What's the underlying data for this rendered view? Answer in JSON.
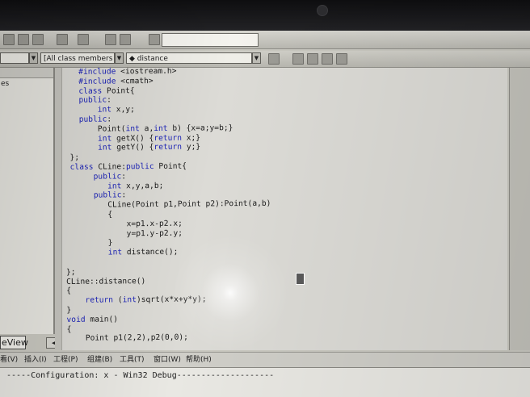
{
  "toolbar": {
    "icons": [
      "cut-icon",
      "copy-icon",
      "paste-icon",
      "undo-icon",
      "redo-icon",
      "window-icon",
      "find-icon",
      "binoculars-icon"
    ],
    "find_value": ""
  },
  "wizard_bar": {
    "scope_value": "",
    "class_value": "[All class members",
    "member_value": "◆ distance"
  },
  "workspace": {
    "pane_label": "es",
    "tab_label": "eView"
  },
  "editor": {
    "lines": [
      "    #include <iostream.h>",
      "    #include <cmath>",
      "    class Point{",
      "    public:",
      "        int x,y;",
      "    public:",
      "        Point(int a,int b) {x=a;y=b;}",
      "        int getX() {return x;}",
      "        int getY() {return y;}",
      "  };",
      "  class CLine:public Point{",
      "       public:",
      "          int x,y,a,b;",
      "       public:",
      "          CLine(Point p1,Point p2):Point(a,b)",
      "          {",
      "              x=p1.x-p2.x;",
      "              y=p1.y-p2.y;",
      "          }",
      "          int distance();",
      "",
      " };",
      " CLine::distance()",
      " {",
      "     return (int)sqrt(x*x+y*y);",
      " }",
      " void main()",
      " {",
      "     Point p1(2,2),p2(0,0);"
    ]
  },
  "menu": {
    "items": [
      "看(V)",
      "插入(I)",
      "工程(P)",
      "组建(B)",
      "工具(T)",
      "窗口(W)",
      "帮助(H)"
    ]
  },
  "output": {
    "line": "-----Configuration: x - Win32 Debug--------------------"
  }
}
